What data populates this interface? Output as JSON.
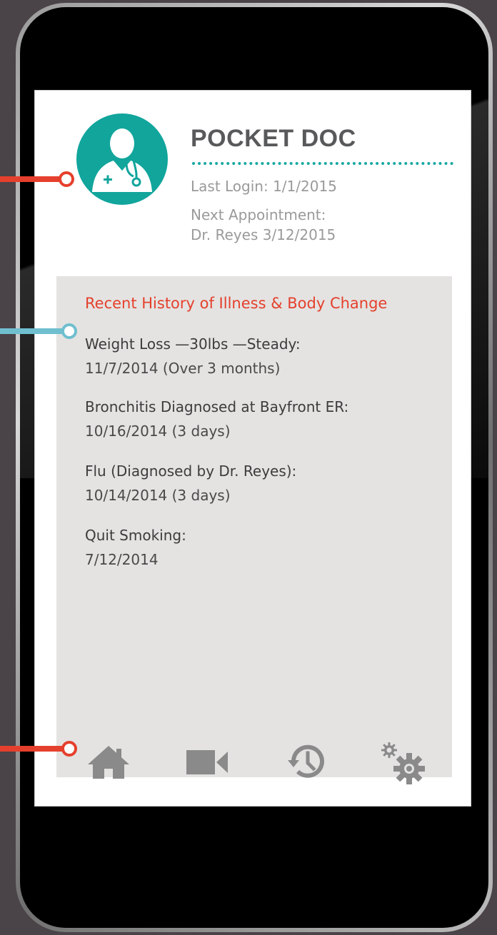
{
  "app": {
    "title": "POCKET DOC",
    "last_login": "Last Login: 1/1/2015",
    "next_appointment_label": "Next Appointment:",
    "next_appointment_value": "Dr. Reyes 3/12/2015",
    "avatar_icon": "doctor-icon",
    "accent_color": "#11a59c"
  },
  "history": {
    "title": "Recent History of Illness & Body Change",
    "title_color": "#e5402d",
    "entries": [
      {
        "head": "Weight Loss —30lbs —Steady:",
        "sub": "11/7/2014 (Over 3 months)"
      },
      {
        "head": "Bronchitis Diagnosed at Bayfront ER:",
        "sub": "10/16/2014 (3 days)"
      },
      {
        "head": "Flu (Diagnosed by Dr. Reyes):",
        "sub": "10/14/2014 (3 days)"
      },
      {
        "head": "Quit Smoking:",
        "sub": "7/12/2014"
      }
    ]
  },
  "nav": {
    "items": [
      {
        "icon": "home-icon"
      },
      {
        "icon": "video-camera-icon"
      },
      {
        "icon": "history-icon"
      },
      {
        "icon": "settings-gears-icon"
      }
    ]
  },
  "connectors": {
    "colors": {
      "red": "#e5402d",
      "blue": "#6fbfcf"
    }
  }
}
